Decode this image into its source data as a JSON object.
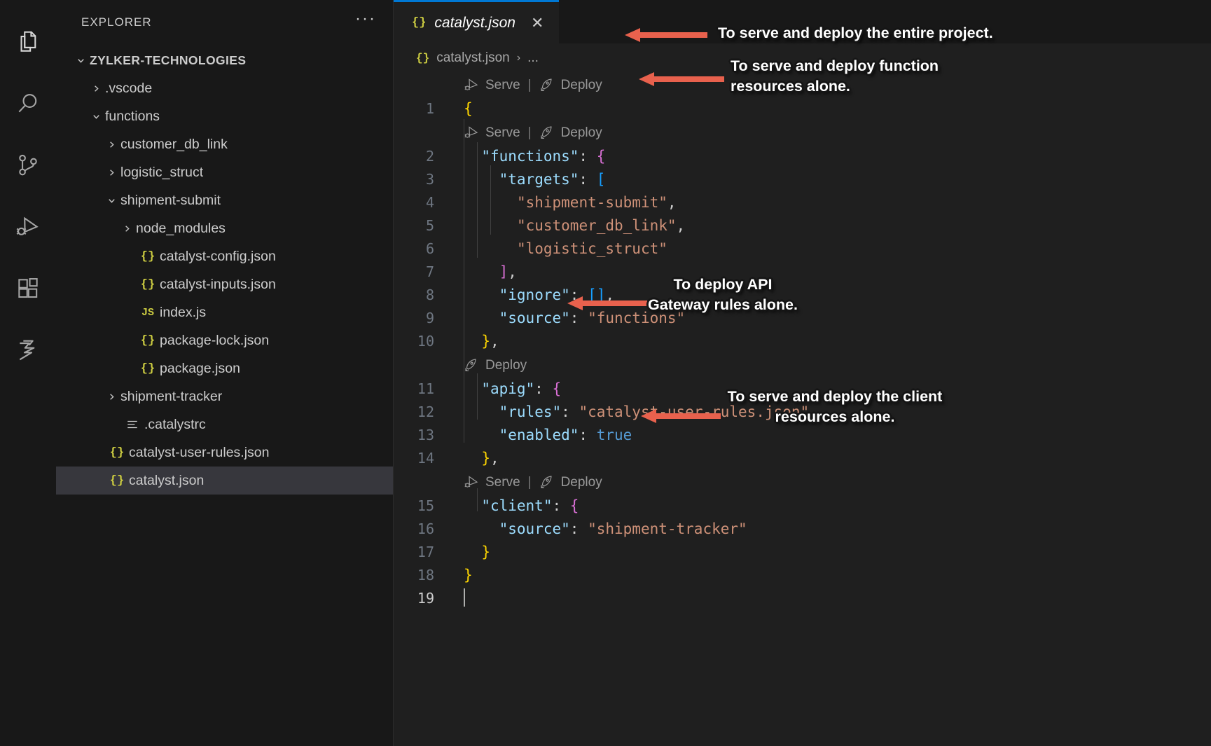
{
  "activity_bar": {
    "items": [
      {
        "name": "explorer-icon",
        "label": "Explorer"
      },
      {
        "name": "search-icon",
        "label": "Search"
      },
      {
        "name": "source-control-icon",
        "label": "Source Control"
      },
      {
        "name": "run-and-debug-icon",
        "label": "Run and Debug"
      },
      {
        "name": "extensions-icon",
        "label": "Extensions"
      },
      {
        "name": "catalyst-icon",
        "label": "Catalyst"
      }
    ]
  },
  "sidebar": {
    "title": "EXPLORER",
    "more_actions": "···",
    "root": {
      "label": "ZYLKER-TECHNOLOGIES",
      "expanded": true
    },
    "tree": [
      {
        "label": ".vscode",
        "indent": 1,
        "kind": "folder",
        "expanded": false,
        "selected": false
      },
      {
        "label": "functions",
        "indent": 1,
        "kind": "folder",
        "expanded": true,
        "selected": false
      },
      {
        "label": "customer_db_link",
        "indent": 2,
        "kind": "folder",
        "expanded": false,
        "selected": false
      },
      {
        "label": "logistic_struct",
        "indent": 2,
        "kind": "folder",
        "expanded": false,
        "selected": false
      },
      {
        "label": "shipment-submit",
        "indent": 2,
        "kind": "folder",
        "expanded": true,
        "selected": false
      },
      {
        "label": "node_modules",
        "indent": 3,
        "kind": "folder",
        "expanded": false,
        "selected": false
      },
      {
        "label": "catalyst-config.json",
        "indent": 3,
        "kind": "json",
        "selected": false
      },
      {
        "label": "catalyst-inputs.json",
        "indent": 3,
        "kind": "json",
        "selected": false
      },
      {
        "label": "index.js",
        "indent": 3,
        "kind": "js",
        "selected": false
      },
      {
        "label": "package-lock.json",
        "indent": 3,
        "kind": "json",
        "selected": false
      },
      {
        "label": "package.json",
        "indent": 3,
        "kind": "json",
        "selected": false
      },
      {
        "label": "shipment-tracker",
        "indent": 2,
        "kind": "folder",
        "expanded": false,
        "selected": false
      },
      {
        "label": ".catalystrc",
        "indent": 2,
        "kind": "rc",
        "selected": false
      },
      {
        "label": "catalyst-user-rules.json",
        "indent": 1,
        "kind": "json",
        "selected": false
      },
      {
        "label": "catalyst.json",
        "indent": 1,
        "kind": "json",
        "selected": true
      }
    ]
  },
  "editor": {
    "tab": {
      "label": "catalyst.json",
      "icon": "{}",
      "close": "✕",
      "active": true,
      "preview_italic": true
    },
    "breadcrumb": {
      "icon": "{}",
      "file": "catalyst.json",
      "separator": "›",
      "more": "..."
    },
    "codelens": {
      "serve_label": "Serve",
      "deploy_label": "Deploy",
      "separator": "|"
    },
    "lines": [
      {
        "num": "1",
        "text": "{"
      },
      {
        "num": "2",
        "text": "  \"functions\": {"
      },
      {
        "num": "3",
        "text": "    \"targets\": ["
      },
      {
        "num": "4",
        "text": "      \"shipment-submit\","
      },
      {
        "num": "5",
        "text": "      \"customer_db_link\","
      },
      {
        "num": "6",
        "text": "      \"logistic_struct\""
      },
      {
        "num": "7",
        "text": "    ],"
      },
      {
        "num": "8",
        "text": "    \"ignore\": [],"
      },
      {
        "num": "9",
        "text": "    \"source\": \"functions\""
      },
      {
        "num": "10",
        "text": "  },"
      },
      {
        "num": "11",
        "text": "  \"apig\": {"
      },
      {
        "num": "12",
        "text": "    \"rules\": \"catalyst-user-rules.json\","
      },
      {
        "num": "13",
        "text": "    \"enabled\": true"
      },
      {
        "num": "14",
        "text": "  },"
      },
      {
        "num": "15",
        "text": "  \"client\": {"
      },
      {
        "num": "16",
        "text": "    \"source\": \"shipment-tracker\""
      },
      {
        "num": "17",
        "text": "  }"
      },
      {
        "num": "18",
        "text": "}"
      },
      {
        "num": "19",
        "text": ""
      }
    ]
  },
  "annotations": [
    {
      "id": "anno-project",
      "text": "To serve and deploy the entire project."
    },
    {
      "id": "anno-functions",
      "text": "To serve and deploy function\nresources alone."
    },
    {
      "id": "anno-apig",
      "text": "To deploy API\nGateway rules alone."
    },
    {
      "id": "anno-client",
      "text": "To serve and deploy the client\nresources alone."
    }
  ],
  "colors": {
    "accent_tab_border": "#0078D4",
    "annotation_arrow": "#E8614D",
    "editor_background": "#1F1F1F",
    "sidebar_background": "#181818",
    "selected_row": "#37373D",
    "json_key": "#9CDCFE",
    "json_string": "#CE9178",
    "json_boolean": "#569CD6",
    "bracket_level1": "#FFD700",
    "bracket_level2": "#DA70D6",
    "bracket_level3": "#179FFF"
  }
}
